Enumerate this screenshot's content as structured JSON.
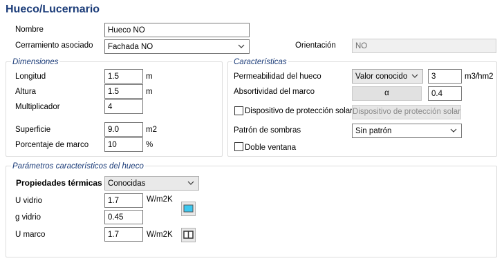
{
  "window": {
    "title": "Hueco/Lucernario"
  },
  "general": {
    "nombre_label": "Nombre",
    "nombre_value": "Hueco NO",
    "cerramiento_label": "Cerramiento asociado",
    "cerramiento_value": "Fachada NO",
    "orientacion_label": "Orientación",
    "orientacion_value": "NO"
  },
  "dimensiones": {
    "title": "Dimensiones",
    "longitud": {
      "label": "Longitud",
      "value": "1.5",
      "unit": "m"
    },
    "altura": {
      "label": "Altura",
      "value": "1.5",
      "unit": "m"
    },
    "multiplicador": {
      "label": "Multiplicador",
      "value": "4"
    },
    "superficie": {
      "label": "Superficie",
      "value": "9.0",
      "unit": "m2"
    },
    "porcentaje": {
      "label": "Porcentaje de marco",
      "value": "10",
      "unit": "%"
    }
  },
  "caracteristicas": {
    "title": "Características",
    "permeabilidad_label": "Permeabilidad del hueco",
    "permeabilidad_select": "Valor conocido",
    "permeabilidad_value": "3",
    "permeabilidad_unit": "m3/hm2",
    "absortividad_label": "Absortividad del marco",
    "absortividad_button": "α",
    "absortividad_value": "0.4",
    "dispositivo_checkbox_label": "Dispositivo de protección solar",
    "dispositivo_button": "Dispositivo de protección solar",
    "patron_label": "Patrón de sombras",
    "patron_value": "Sin patrón",
    "doble_ventana_label": "Doble ventana"
  },
  "parametros": {
    "title": "Parámetros característicos del hueco",
    "propiedades_label": "Propiedades térmicas",
    "propiedades_value": "Conocidas",
    "u_vidrio": {
      "label": "U vidrio",
      "value": "1.7",
      "unit": "W/m2K"
    },
    "g_vidrio": {
      "label": "g vidrio",
      "value": "0.45"
    },
    "u_marco": {
      "label": "U marco",
      "value": "1.7",
      "unit": "W/m2K"
    }
  },
  "colors": {
    "accent": "#1a3b78",
    "glass": "#3cc8f0"
  }
}
